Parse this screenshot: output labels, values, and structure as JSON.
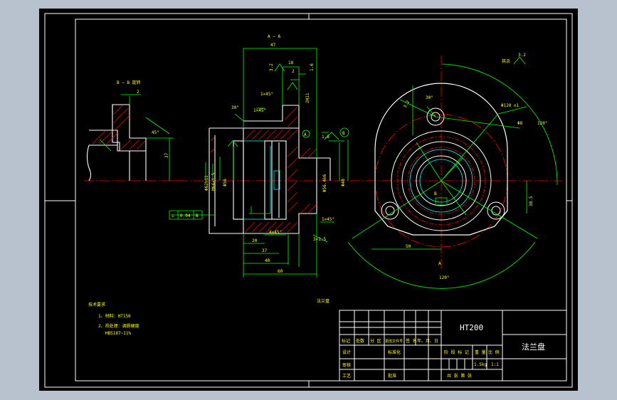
{
  "app": {
    "viewport_bg": "#b8c2cf",
    "sheet_bg": "#000000",
    "colors": {
      "outline": "#ffffff",
      "dimension": "#00ff00",
      "centerline": "#ff0000",
      "hatch": "#ff0000",
      "text": "#ffff00",
      "accent": "#00ffff"
    }
  },
  "views": {
    "section_a_label": "A — A",
    "detail_b_label": "B — B  旋转",
    "view_a_arrow": "A",
    "view_b_arrow": "B",
    "part_tag": "法兰盘"
  },
  "dimensions": {
    "d_47": "47",
    "d_18": "18",
    "d_2": "2",
    "d_ra_16": "1.6",
    "d_ra_32": "3.2",
    "d_1x45_top": "1×45°",
    "d_1x45_mid": "1×45°",
    "d_1x45_bot": "1×45°",
    "d_30deg": "30°",
    "d_2h11": "2H11",
    "d_dia62": "Φ62h11",
    "d_m64": "M64×1.5",
    "d_dia56": "Φ56",
    "d_dia56_k6": "Φ56.4k6",
    "d_dia48": "Φ48",
    "d_4x45": "4×45°",
    "d_20": "20",
    "d_37": "37",
    "d_40": "40",
    "d_60": "60",
    "d_3x15": "3×1.5",
    "d_37_side": "37",
    "d_2_detail": "2",
    "d_45deg": "45°",
    "d_bore_ra": "3.2",
    "d_30_angle": "30°",
    "d_dia120": "Φ120 ±1",
    "d_dia8": "Φ8",
    "d_120deg": "120°",
    "d_50": "50",
    "d_38": "38.5",
    "d_120_bottom": "120°",
    "d_rest_ra": "其余",
    "d_ra_top": "3.2",
    "tolerance_symbol": "⟂",
    "tolerance_value": "0.04",
    "tolerance_datum": "B",
    "datum_a": "A",
    "datum_b": "B",
    "d_dim_vert": "1.6"
  },
  "notes": {
    "title": "技术要求",
    "line1": "1、材料：HT150",
    "line2": "2、热处理：调质硬度",
    "line3": "HBS187~11%"
  },
  "title_block": {
    "material": "HT200",
    "part_name": "法兰盘",
    "row_headers": [
      "标记",
      "处数",
      "分 区",
      "更改文件号",
      "签 名",
      "年、月、日"
    ],
    "design": "设计",
    "standard": "标准化",
    "review": "审核",
    "process": "工艺",
    "approve": "批准",
    "stage_mark": "阶 段 标 记",
    "weight": "重 量",
    "scale": "比 例",
    "weight_value": "1.5kg",
    "scale_value": "1:1",
    "sheets": "共    张   第    张"
  }
}
